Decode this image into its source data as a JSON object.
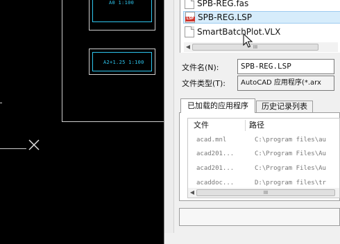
{
  "cad": {
    "viewport_a0_label": "A0 1:100",
    "viewport_a2_label": "A2+1.25 1:100",
    "line_color": "#cfcfcf",
    "accent_color": "#2ec7f0"
  },
  "file_list": {
    "items": [
      {
        "name": "SPB-REG.fas",
        "icon": "document-icon"
      },
      {
        "name": "SPB-REG.LSP",
        "icon": "lsp-file-icon",
        "icon_tag": "LSP",
        "selected": true
      },
      {
        "name": "SmartBatchPlot.VLX",
        "icon": "document-icon"
      }
    ],
    "scroll_grip": "III"
  },
  "form": {
    "filename_label": "文件名(N):",
    "filename_value": "SPB-REG.LSP",
    "filetype_label": "文件类型(T):",
    "filetype_value": "AutoCAD 应用程序(*.arx"
  },
  "tabs": [
    {
      "label": "已加载的应用程序",
      "active": true
    },
    {
      "label": "历史记录列表",
      "active": false
    }
  ],
  "loaded_apps": {
    "columns": [
      "文件",
      "路径"
    ],
    "rows": [
      {
        "file": "acad.mnl",
        "path": "C:\\program files\\au"
      },
      {
        "file": "acad201...",
        "path": "C:\\Program Files\\Au"
      },
      {
        "file": "acad201...",
        "path": "C:\\Program Files\\Au"
      },
      {
        "file": "acaddoc...",
        "path": "D:\\program files\\tr"
      }
    ],
    "scroll_grip": "III"
  }
}
